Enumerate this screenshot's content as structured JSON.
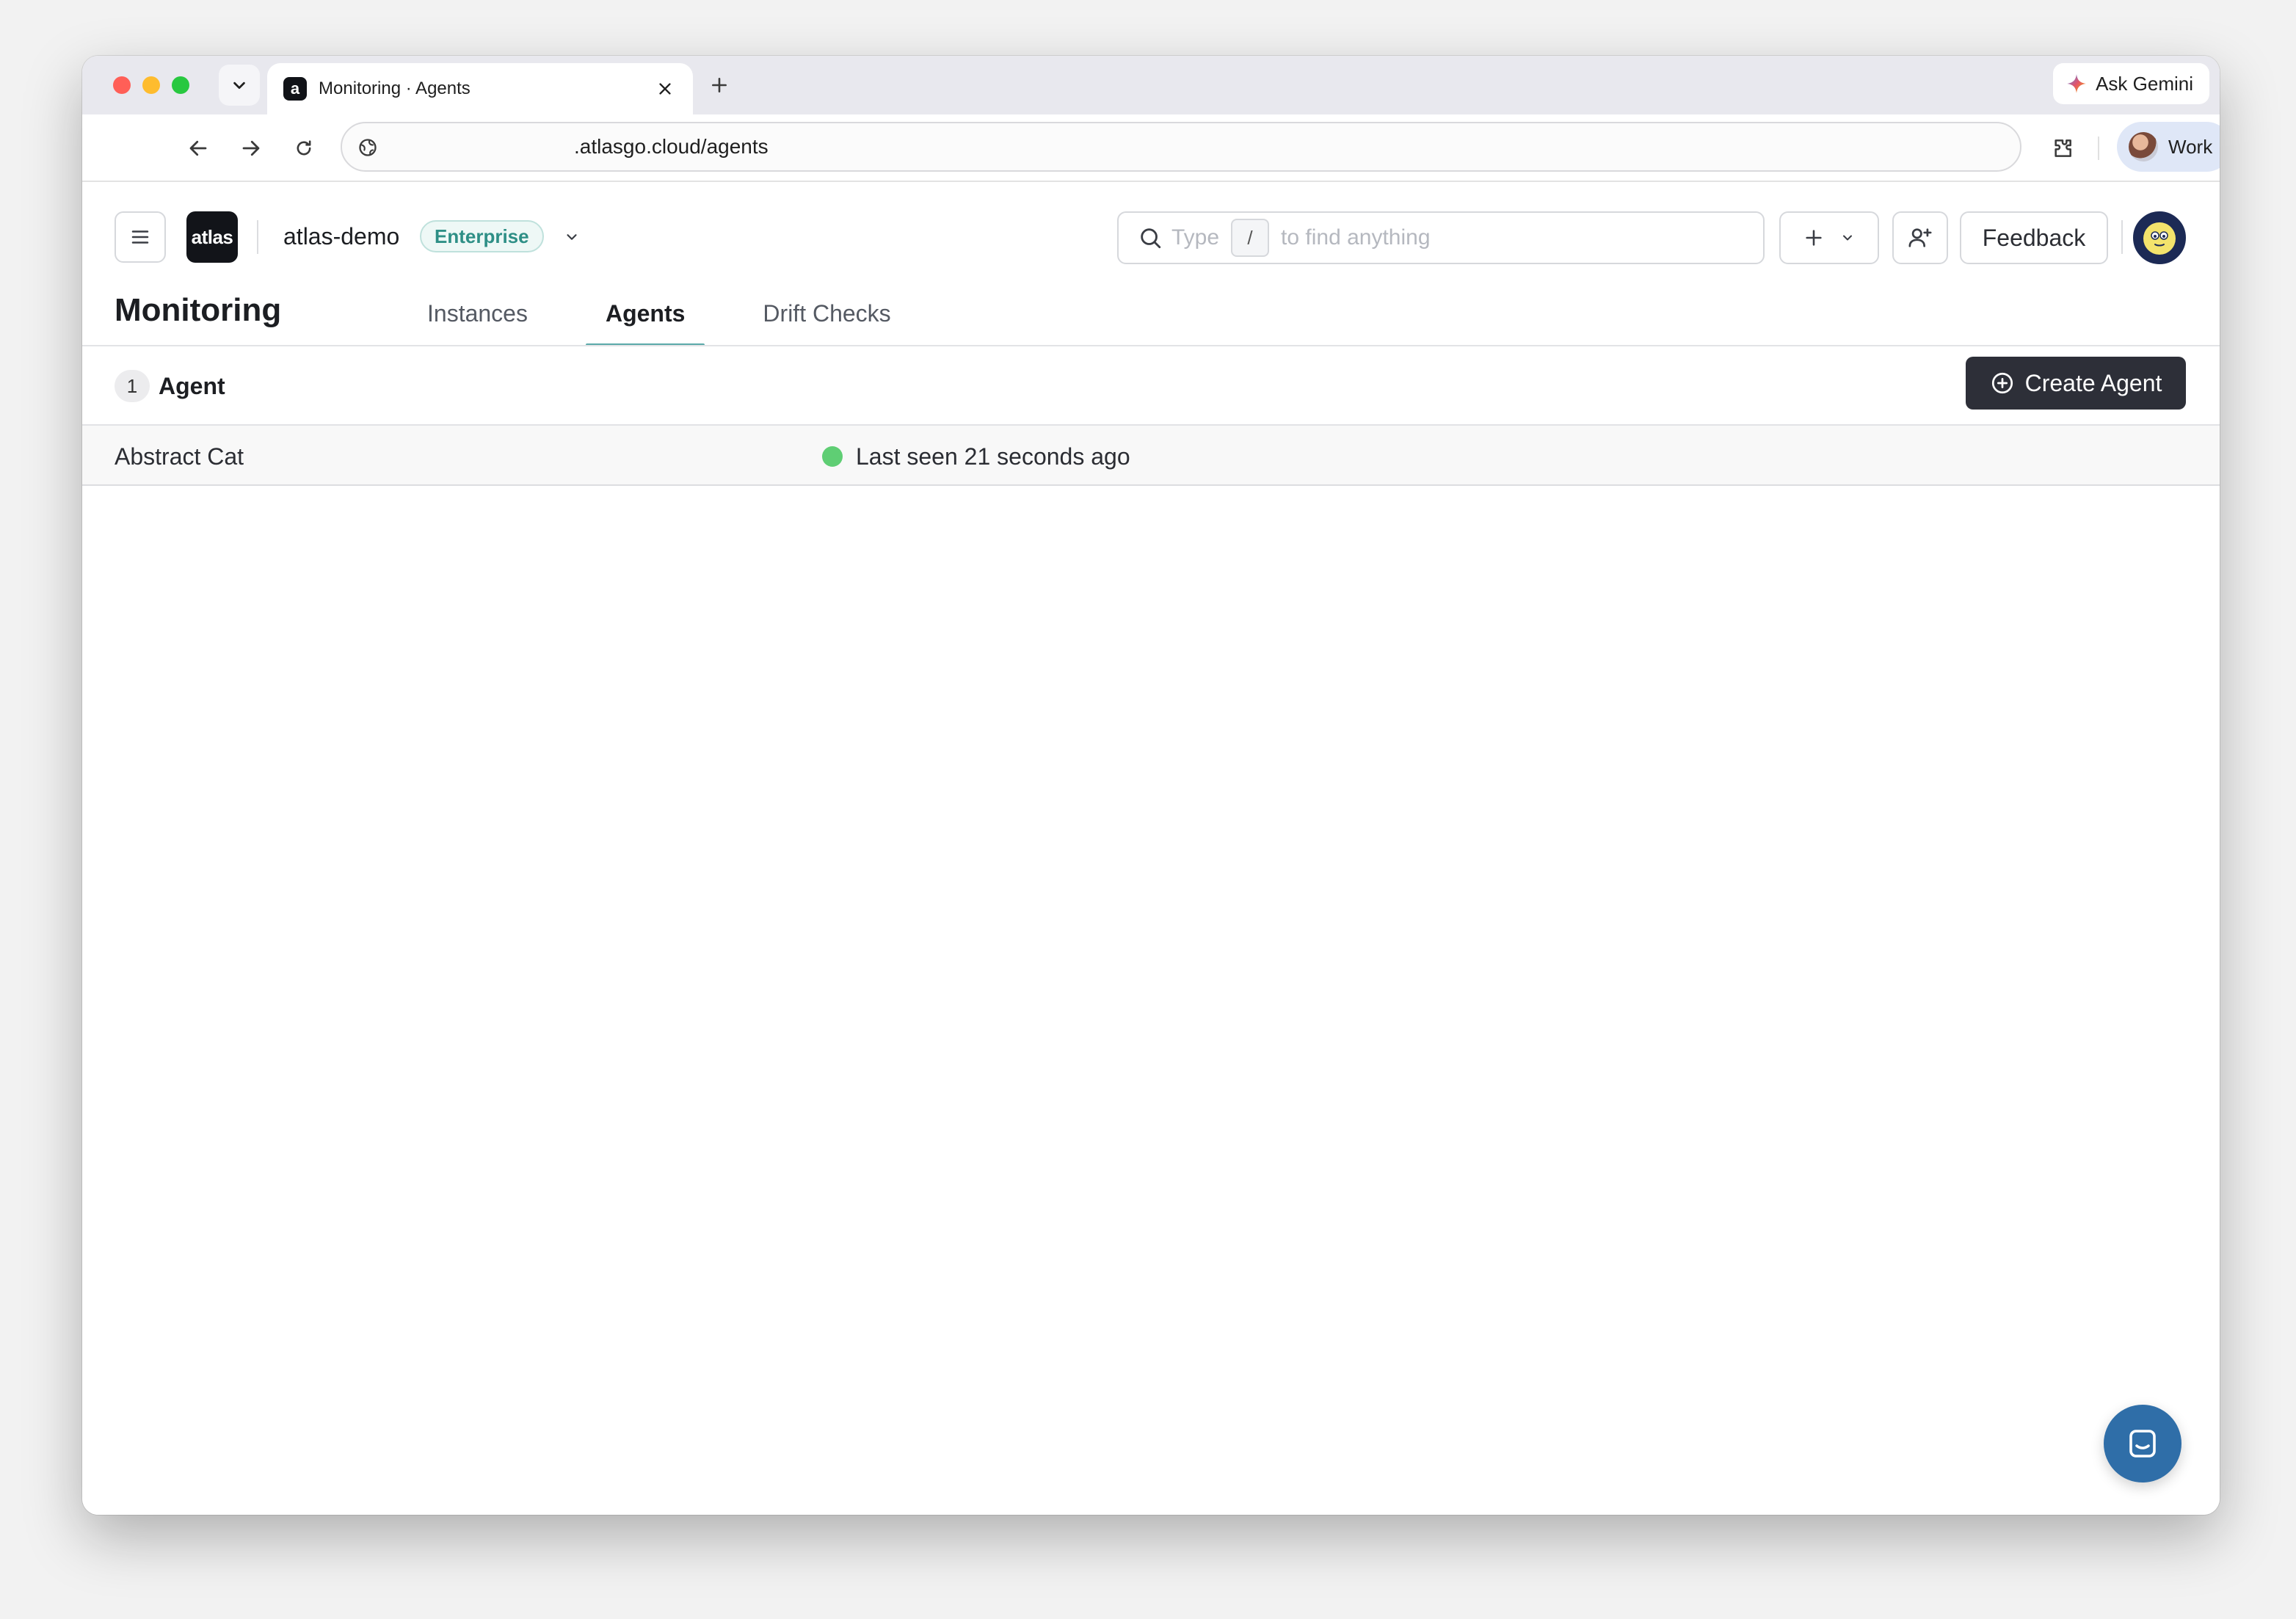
{
  "browser": {
    "tab_title": "Monitoring · Agents",
    "tab_favicon_letter": "a",
    "url": ".atlasgo.cloud/agents",
    "ask_gemini_label": "Ask Gemini",
    "profile_label": "Work"
  },
  "header": {
    "logo_text": "atlas",
    "org_name": "atlas-demo",
    "plan_badge": "Enterprise",
    "search": {
      "prefix": "Type",
      "shortcut_key": "/",
      "suffix": "to find anything"
    },
    "feedback_label": "Feedback"
  },
  "page": {
    "title": "Monitoring",
    "tabs": [
      {
        "label": "Instances",
        "active": false
      },
      {
        "label": "Agents",
        "active": true
      },
      {
        "label": "Drift Checks",
        "active": false
      }
    ]
  },
  "agents": {
    "count": "1",
    "count_label": "Agent",
    "create_button_label": "Create Agent",
    "rows": [
      {
        "name": "Abstract Cat",
        "status": "Last seen 21 seconds ago",
        "status_color": "#5fce74"
      }
    ]
  },
  "colors": {
    "accent_tab_underline": "#5aa9a9",
    "primary_button": "#2d2f38",
    "chat_launcher": "#2f6ea8",
    "plan_badge_text": "#2e8f86"
  },
  "icons": {
    "tab_search": "chevron-down-icon",
    "tab_close": "close-icon",
    "new_tab": "plus-icon",
    "back": "arrow-left-icon",
    "forward": "arrow-right-icon",
    "reload": "reload-icon",
    "site_info": "globe-icon",
    "extensions": "puzzle-icon",
    "browser_menu": "more-vertical-icon",
    "hamburger": "menu-icon",
    "search": "search-icon",
    "add": "plus-icon",
    "invite": "user-plus-icon",
    "create": "plus-circle-icon",
    "chat": "chat-icon"
  }
}
